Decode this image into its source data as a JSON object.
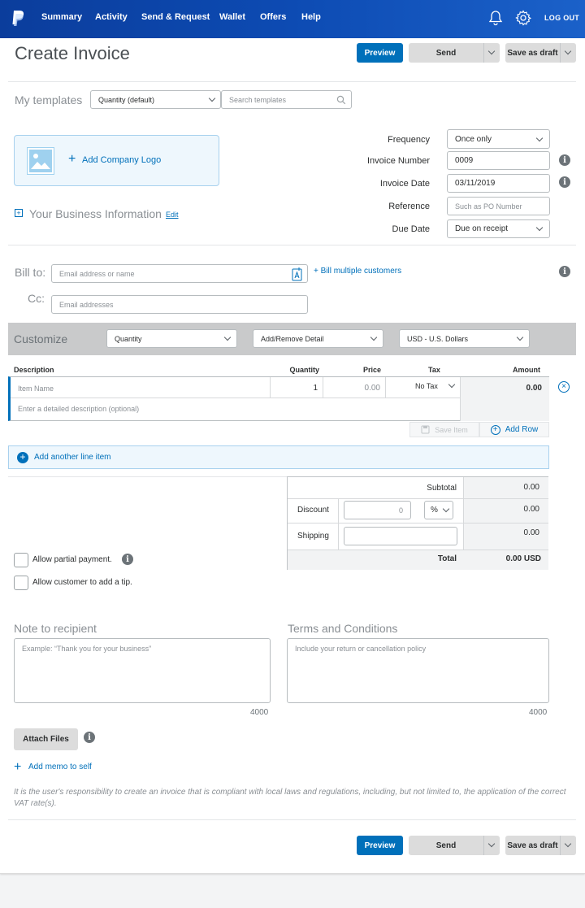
{
  "nav": {
    "items": [
      "Summary",
      "Activity",
      "Send & Request",
      "Wallet",
      "Offers",
      "Help"
    ],
    "logout": "LOG OUT"
  },
  "header": {
    "title": "Create Invoice",
    "preview": "Preview",
    "send": "Send",
    "save_draft": "Save as draft"
  },
  "templates": {
    "label": "My templates",
    "selected": "Quantity (default)",
    "search_placeholder": "Search templates"
  },
  "logo": {
    "label": "Add Company Logo"
  },
  "business": {
    "label": "Your Business Information",
    "edit": "Edit"
  },
  "details": {
    "frequency_label": "Frequency",
    "frequency": "Once only",
    "invoice_number_label": "Invoice Number",
    "invoice_number": "0009",
    "invoice_date_label": "Invoice Date",
    "invoice_date": "03/11/2019",
    "reference_label": "Reference",
    "reference_placeholder": "Such as PO Number",
    "due_date_label": "Due Date",
    "due_date": "Due on receipt"
  },
  "billing": {
    "bill_to_label": "Bill to:",
    "bill_to_placeholder": "Email address or name",
    "bill_multiple": "+ Bill multiple customers",
    "cc_label": "Cc:",
    "cc_placeholder": "Email addresses"
  },
  "customize": {
    "label": "Customize",
    "quantity": "Quantity",
    "add_remove": "Add/Remove Detail",
    "currency": "USD - U.S. Dollars"
  },
  "table": {
    "headers": {
      "description": "Description",
      "quantity": "Quantity",
      "price": "Price",
      "tax": "Tax",
      "amount": "Amount"
    },
    "item_name_placeholder": "Item Name",
    "quantity": "1",
    "price_placeholder": "0.00",
    "tax": "No Tax",
    "amount": "0.00",
    "desc_placeholder": "Enter a detailed description (optional)",
    "save_item": "Save Item",
    "add_row": "Add Row",
    "add_line": "Add another line item"
  },
  "totals": {
    "subtotal_label": "Subtotal",
    "subtotal": "0.00",
    "discount_label": "Discount",
    "discount_placeholder": "0",
    "discount_unit": "%",
    "discount": "0.00",
    "shipping_label": "Shipping",
    "shipping": "0.00",
    "total_label": "Total",
    "total": "0.00 USD"
  },
  "options": {
    "partial_payment": "Allow partial payment.",
    "tip": "Allow customer to add a tip."
  },
  "note": {
    "label": "Note to recipient",
    "placeholder": "Example: “Thank you for your business”",
    "count": "4000"
  },
  "terms": {
    "label": "Terms and Conditions",
    "placeholder": "Include your return or cancellation policy",
    "count": "4000"
  },
  "attach": "Attach Files",
  "memo": "Add memo to self",
  "disclaimer": "It is the user's responsibility to create an invoice that is compliant with local laws and regulations, including, but not limited to, the application of the correct VAT rate(s).",
  "footer": {
    "preview": "Preview",
    "send": "Send",
    "save_draft": "Save as draft"
  },
  "colors": {
    "brand": "#0070ba",
    "nav": "#0d4bb3"
  }
}
